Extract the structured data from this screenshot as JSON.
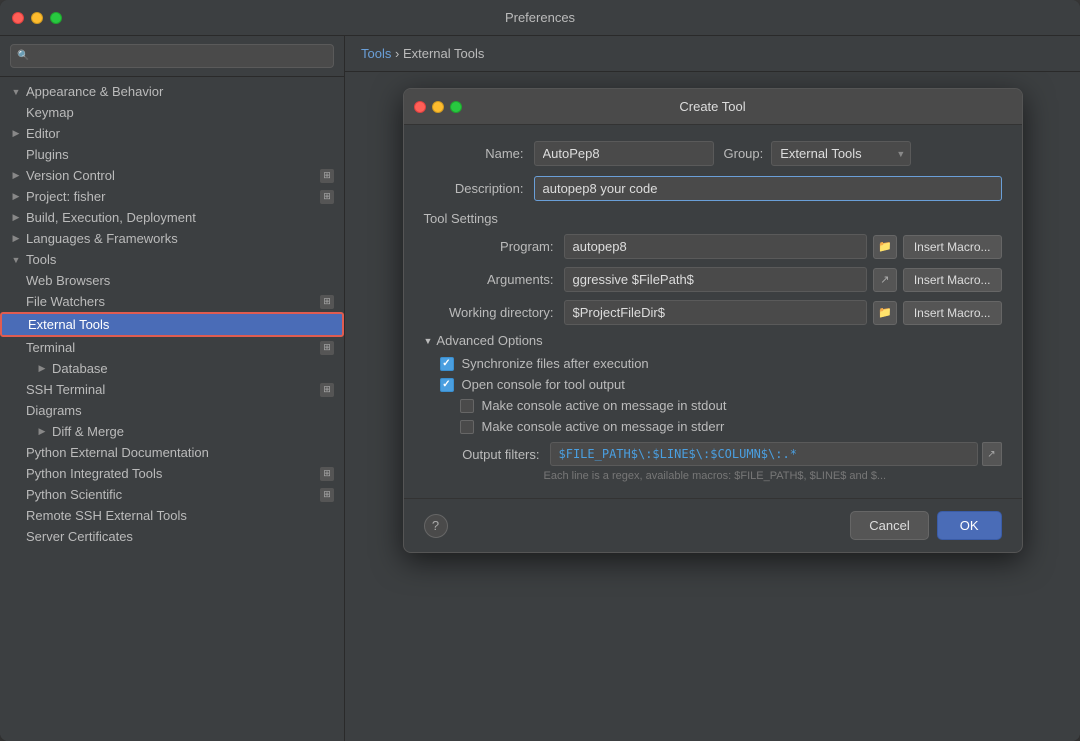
{
  "window": {
    "title": "Preferences"
  },
  "breadcrumb": {
    "root": "Tools",
    "separator": "›",
    "current": "External Tools"
  },
  "sidebar": {
    "search_placeholder": "🔍",
    "items": [
      {
        "id": "appearance",
        "label": "Appearance & Behavior",
        "type": "group",
        "expanded": true,
        "indent": 0
      },
      {
        "id": "keymap",
        "label": "Keymap",
        "type": "item",
        "indent": 1
      },
      {
        "id": "editor",
        "label": "Editor",
        "type": "group",
        "indent": 0
      },
      {
        "id": "plugins",
        "label": "Plugins",
        "type": "item",
        "indent": 1
      },
      {
        "id": "version-control",
        "label": "Version Control",
        "type": "group",
        "indent": 0,
        "has-badge": true
      },
      {
        "id": "project-fisher",
        "label": "Project: fisher",
        "type": "group",
        "indent": 0,
        "has-badge": true
      },
      {
        "id": "build-exec",
        "label": "Build, Execution, Deployment",
        "type": "group",
        "indent": 0
      },
      {
        "id": "languages",
        "label": "Languages & Frameworks",
        "type": "group",
        "indent": 0
      },
      {
        "id": "tools",
        "label": "Tools",
        "type": "group",
        "indent": 0,
        "expanded": true
      },
      {
        "id": "web-browsers",
        "label": "Web Browsers",
        "type": "item",
        "indent": 1
      },
      {
        "id": "file-watchers",
        "label": "File Watchers",
        "type": "item",
        "indent": 1,
        "has-badge": true
      },
      {
        "id": "external-tools",
        "label": "External Tools",
        "type": "item",
        "indent": 1,
        "selected": true
      },
      {
        "id": "terminal",
        "label": "Terminal",
        "type": "item",
        "indent": 1,
        "has-badge": true
      },
      {
        "id": "database",
        "label": "Database",
        "type": "group",
        "indent": 1
      },
      {
        "id": "ssh-terminal",
        "label": "SSH Terminal",
        "type": "item",
        "indent": 1,
        "has-badge": true
      },
      {
        "id": "diagrams",
        "label": "Diagrams",
        "type": "item",
        "indent": 1
      },
      {
        "id": "diff-merge",
        "label": "Diff & Merge",
        "type": "group",
        "indent": 1
      },
      {
        "id": "python-ext-docs",
        "label": "Python External Documentation",
        "type": "item",
        "indent": 1
      },
      {
        "id": "python-int-tools",
        "label": "Python Integrated Tools",
        "type": "item",
        "indent": 1,
        "has-badge": true
      },
      {
        "id": "python-scientific",
        "label": "Python Scientific",
        "type": "item",
        "indent": 1,
        "has-badge": true
      },
      {
        "id": "remote-ssh",
        "label": "Remote SSH External Tools",
        "type": "item",
        "indent": 1
      },
      {
        "id": "server-certs",
        "label": "Server Certificates",
        "type": "item",
        "indent": 1
      }
    ]
  },
  "dialog": {
    "title": "Create Tool",
    "name_label": "Name:",
    "name_value": "AutoPep8",
    "group_label": "Group:",
    "group_value": "External Tools",
    "description_label": "Description:",
    "description_value": "autopep8 your code",
    "tool_settings_label": "Tool Settings",
    "program_label": "Program:",
    "program_value": "autopep8",
    "arguments_label": "Arguments:",
    "arguments_value": "ggressive $FilePath$",
    "working_dir_label": "Working directory:",
    "working_dir_value": "$ProjectFileDir$",
    "insert_macro": "Insert Macro...",
    "advanced_label": "Advanced Options",
    "sync_files_label": "Synchronize files after execution",
    "sync_files_checked": true,
    "open_console_label": "Open console for tool output",
    "open_console_checked": true,
    "make_active_stdout_label": "Make console active on message in stdout",
    "make_active_stdout_checked": false,
    "make_active_stderr_label": "Make console active on message in stderr",
    "make_active_stderr_checked": false,
    "output_filters_label": "Output filters:",
    "output_filters_value": "$FILE_PATH$\\:$LINE$\\:$COLUMN$\\:.*",
    "hint_text": "Each line is a regex, available macros: $FILE_PATH$, $LINE$ and $...",
    "cancel_label": "Cancel",
    "ok_label": "OK"
  }
}
